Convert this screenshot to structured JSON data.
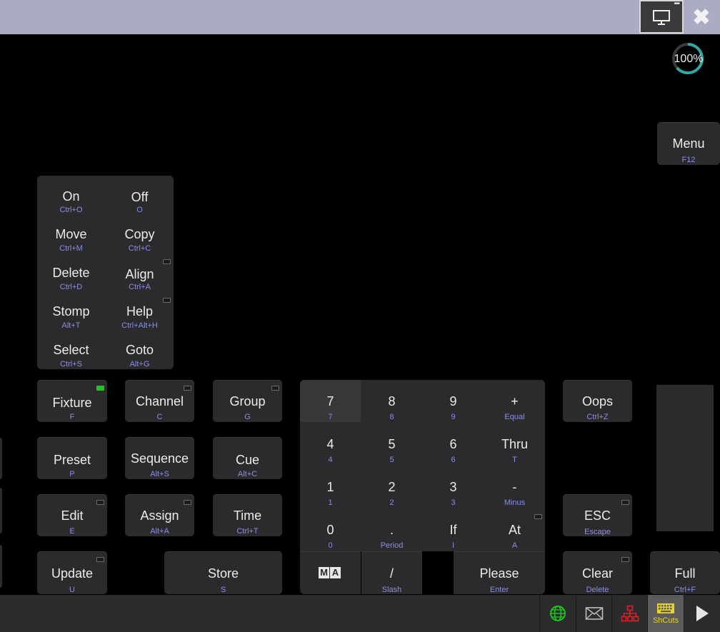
{
  "window": {
    "zoom": "100%"
  },
  "menu": {
    "label": "Menu",
    "shortcut": "F12"
  },
  "command_grid": [
    {
      "label": "On",
      "shortcut": "Ctrl+O"
    },
    {
      "label": "Off",
      "shortcut": "O"
    },
    {
      "label": "Move",
      "shortcut": "Ctrl+M"
    },
    {
      "label": "Copy",
      "shortcut": "Ctrl+C"
    },
    {
      "label": "Delete",
      "shortcut": "Ctrl+D"
    },
    {
      "label": "Align",
      "shortcut": "Ctrl+A"
    },
    {
      "label": "Stomp",
      "shortcut": "Alt+T"
    },
    {
      "label": "Help",
      "shortcut": "Ctrl+Alt+H"
    },
    {
      "label": "Select",
      "shortcut": "Ctrl+S"
    },
    {
      "label": "Goto",
      "shortcut": "Alt+G"
    }
  ],
  "keys": {
    "fixture": {
      "label": "Fixture",
      "shortcut": "F"
    },
    "channel": {
      "label": "Channel",
      "shortcut": "C"
    },
    "group": {
      "label": "Group",
      "shortcut": "G"
    },
    "preset": {
      "label": "Preset",
      "shortcut": "P"
    },
    "sequence": {
      "label": "Sequence",
      "shortcut": "Alt+S"
    },
    "cue": {
      "label": "Cue",
      "shortcut": "Alt+C"
    },
    "edit": {
      "label": "Edit",
      "shortcut": "E"
    },
    "assign": {
      "label": "Assign",
      "shortcut": "Alt+A"
    },
    "time": {
      "label": "Time",
      "shortcut": "Ctrl+T"
    },
    "update": {
      "label": "Update",
      "shortcut": "U"
    },
    "store": {
      "label": "Store",
      "shortcut": "S"
    },
    "oops": {
      "label": "Oops",
      "shortcut": "Ctrl+Z"
    },
    "esc": {
      "label": "ESC",
      "shortcut": "Escape"
    },
    "clear": {
      "label": "Clear",
      "shortcut": "Delete"
    },
    "full": {
      "label": "Full",
      "shortcut": "Ctrl+F"
    }
  },
  "numpad": [
    {
      "label": "7",
      "shortcut": "7"
    },
    {
      "label": "8",
      "shortcut": "8"
    },
    {
      "label": "9",
      "shortcut": "9"
    },
    {
      "label": "+",
      "shortcut": "Equal"
    },
    {
      "label": "4",
      "shortcut": "4"
    },
    {
      "label": "5",
      "shortcut": "5"
    },
    {
      "label": "6",
      "shortcut": "6"
    },
    {
      "label": "Thru",
      "shortcut": "T"
    },
    {
      "label": "1",
      "shortcut": "1"
    },
    {
      "label": "2",
      "shortcut": "2"
    },
    {
      "label": "3",
      "shortcut": "3"
    },
    {
      "label": "-",
      "shortcut": "Minus"
    },
    {
      "label": "0",
      "shortcut": "0"
    },
    {
      "label": ".",
      "shortcut": "Period"
    },
    {
      "label": "If",
      "shortcut": "I"
    },
    {
      "label": "At",
      "shortcut": "A"
    }
  ],
  "numpad_bottom": {
    "ma_logo": [
      "M",
      "A"
    ],
    "slash": {
      "label": "/",
      "shortcut": "Slash"
    },
    "please": {
      "label": "Please",
      "shortcut": "Enter"
    }
  },
  "statusbar": {
    "shcuts_label": "ShCuts"
  },
  "colors": {
    "shortcut_text": "#8a8ee6",
    "led_on": "#26c126",
    "shcuts": "#e8d320",
    "network_alert": "#e02020",
    "globe": "#1fc21f"
  }
}
